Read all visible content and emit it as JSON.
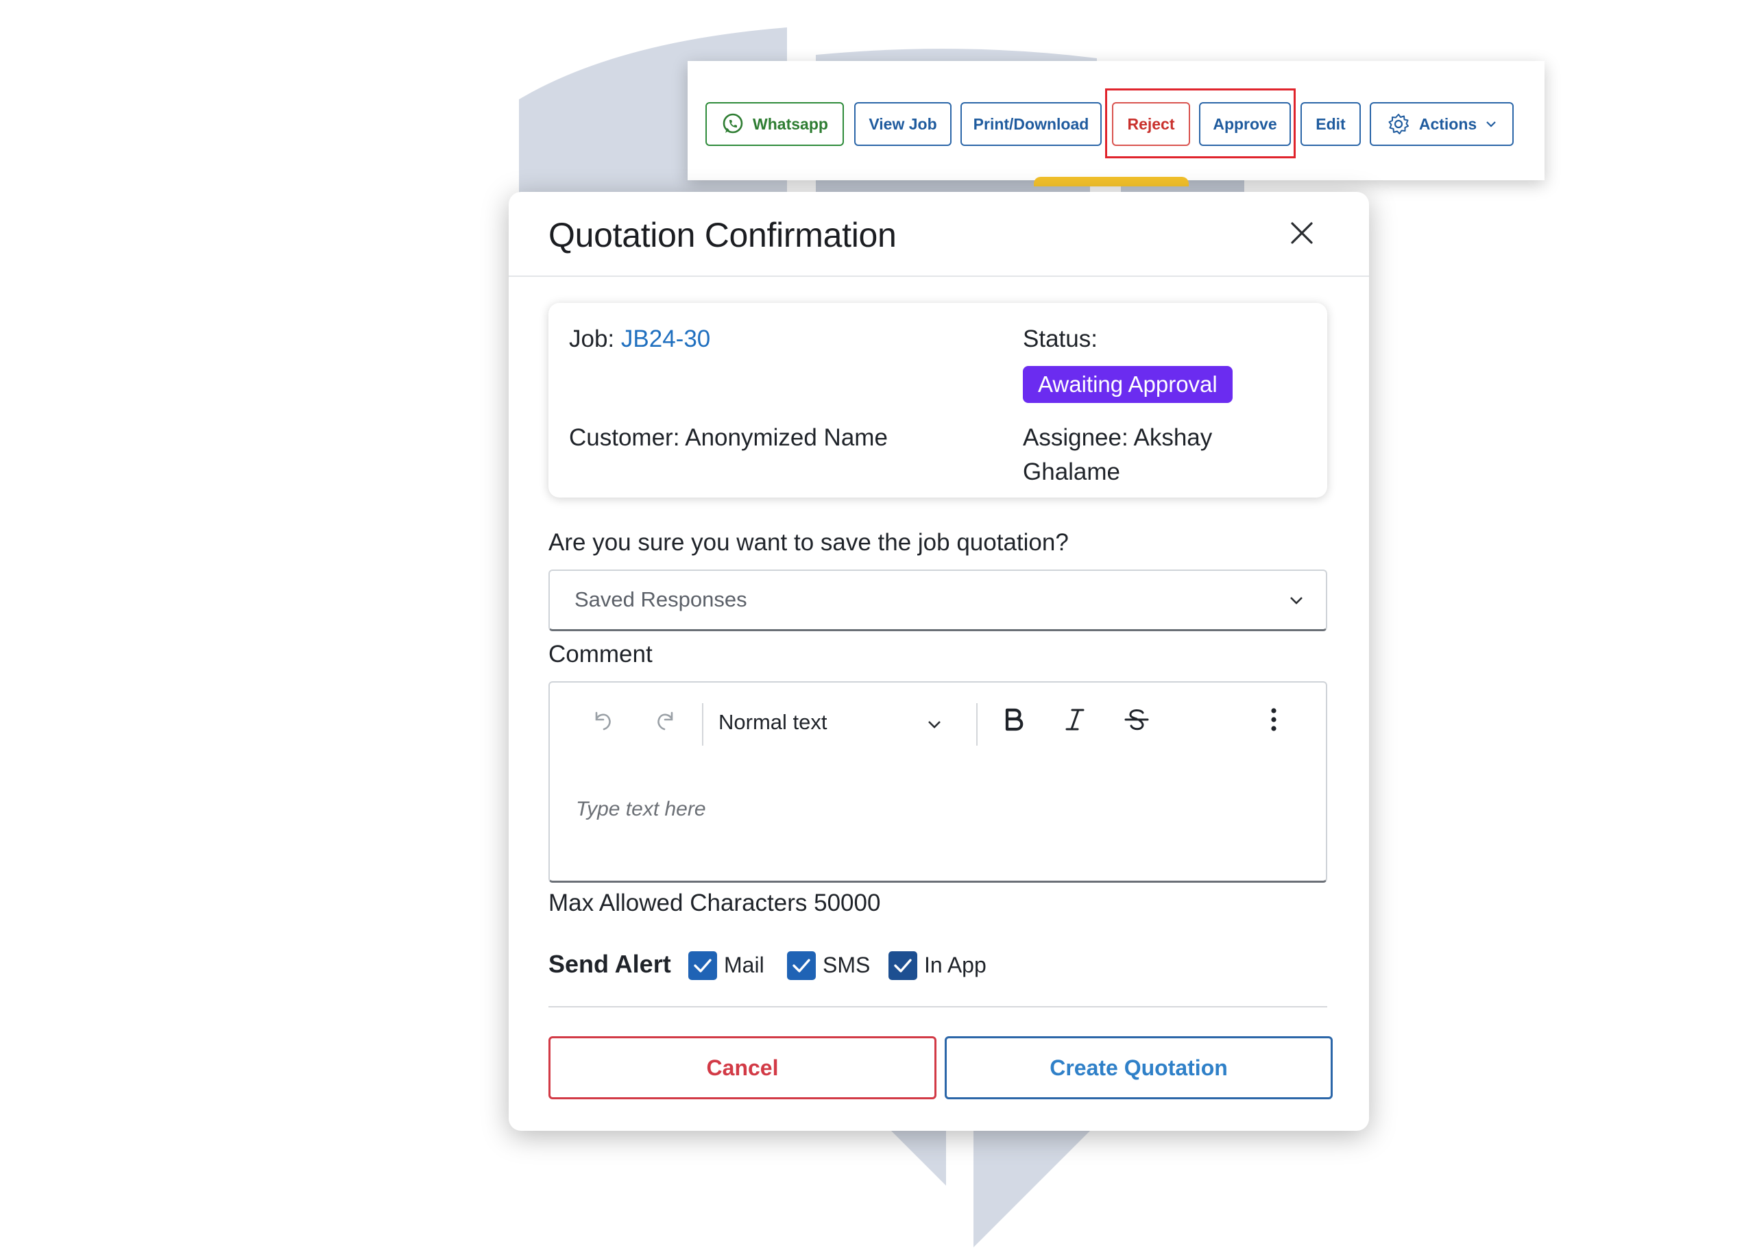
{
  "toolbar": {
    "whatsapp_label": "Whatsapp",
    "view_job_label": "View Job",
    "print_label": "Print/Download",
    "reject_label": "Reject",
    "approve_label": "Approve",
    "edit_label": "Edit",
    "actions_label": "Actions"
  },
  "modal": {
    "title": "Quotation Confirmation",
    "job_prefix": "Job: ",
    "job_id": "JB24-30",
    "status_label": "Status:",
    "status_value": "Awaiting Approval",
    "customer": "Customer: Anonymized Name",
    "assignee_line1": "Assignee: Akshay",
    "assignee_line2": "Ghalame",
    "question": "Are you sure you want to save the job quotation?",
    "saved_responses": "Saved Responses",
    "comment_label": "Comment",
    "format_value": "Normal text",
    "editor_placeholder": "Type text here",
    "max_chars": "Max Allowed Characters 50000",
    "send_alert_label": "Send Alert",
    "alerts": [
      {
        "label": "Mail",
        "checked": true
      },
      {
        "label": "SMS",
        "checked": true
      },
      {
        "label": "In App",
        "checked": true
      }
    ],
    "cancel_label": "Cancel",
    "create_label": "Create Quotation"
  },
  "colors": {
    "primary": "#2b66a8",
    "danger": "#d23a46",
    "status_badge": "#6b2cf0",
    "whatsapp": "#2e8b3a"
  }
}
